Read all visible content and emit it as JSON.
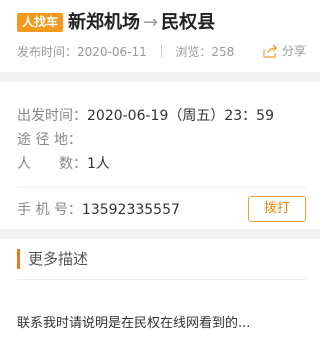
{
  "header": {
    "badge": "人找车",
    "from": "新郑机场",
    "arrow": "→",
    "to": "民权县",
    "publish_label": "发布时间：2020-06-11",
    "views_label": "浏览：258",
    "share_label": "分享"
  },
  "info": {
    "depart_label": "出发时间：",
    "depart_value": "2020-06-19（周五）23：59",
    "via_label": "途 径 地：",
    "via_value": "",
    "people_label": "人　　数：",
    "people_value": "1人",
    "phone_label": "手 机 号：",
    "phone_value": "13592335557",
    "call_button": "拨打"
  },
  "more": {
    "title": "更多描述",
    "description": "联系我时请说明是在民权在线网看到的..."
  },
  "colors": {
    "accent": "#f39a1e",
    "accent_border": "#f0a030",
    "section_bar": "#e87b1a"
  },
  "icons": {
    "share": "share-icon"
  }
}
